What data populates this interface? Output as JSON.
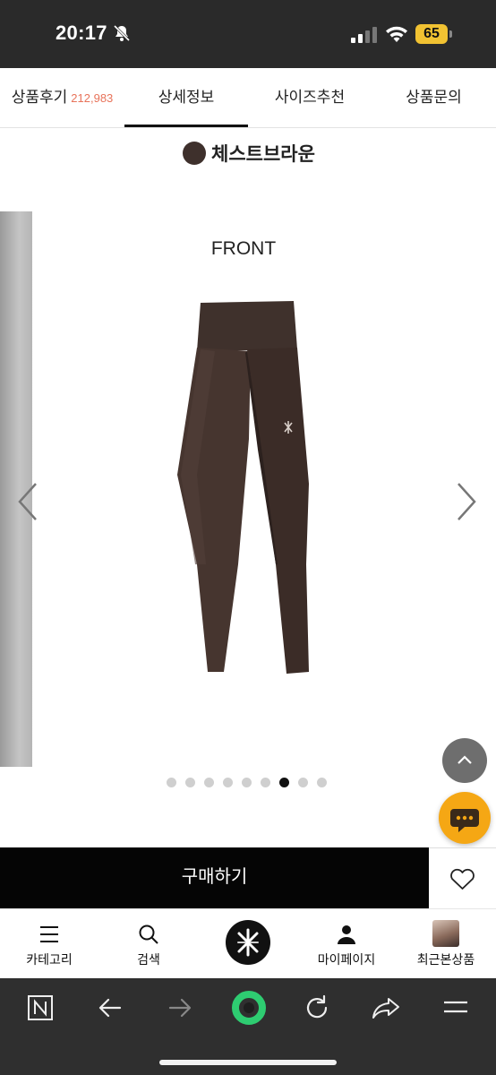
{
  "status_bar": {
    "time": "20:17",
    "battery": "65"
  },
  "tabs": [
    {
      "label": "상품후기",
      "count": "212,983"
    },
    {
      "label": "상세정보"
    },
    {
      "label": "사이즈추천"
    },
    {
      "label": "상품문의"
    }
  ],
  "active_tab": "상세정보",
  "color_option": {
    "name": "체스트브라운",
    "swatch": "#3e302c"
  },
  "carousel": {
    "slide_label": "FRONT",
    "total_slides": 9,
    "active_index": 7
  },
  "purchase": {
    "buy_label": "구매하기"
  },
  "bottom_nav": {
    "category": "카테고리",
    "search": "검색",
    "mypage": "마이페이지",
    "recent": "최근본상품"
  },
  "colors": {
    "accent_chat": "#f5a714",
    "review_count": "#e8735a",
    "browser_ring": "#2ecc71"
  },
  "icons": [
    "bell-slash-icon",
    "signal-icon",
    "wifi-icon",
    "battery-icon",
    "chevron-left-icon",
    "chevron-right-icon",
    "chevron-up-icon",
    "chat-icon",
    "heart-icon",
    "menu-icon",
    "search-icon",
    "brand-logo-icon",
    "person-icon",
    "n-app-icon",
    "back-icon",
    "forward-icon",
    "reload-icon",
    "share-icon",
    "hamburger-icon"
  ]
}
